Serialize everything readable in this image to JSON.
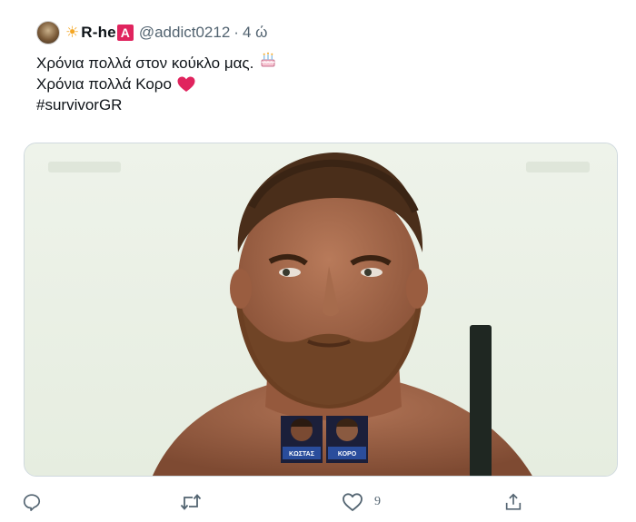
{
  "tweet": {
    "display_name": "R-he",
    "badge_letter": "A",
    "handle": "@addict0212",
    "separator": "·",
    "time": "4 ώ",
    "lines": [
      "Χρόνια πολλά στον κούκλο μας.",
      "Χρόνια πολλά Κορο",
      "#survivorGR"
    ],
    "media": {
      "overlay_labels": [
        "ΚΩΣΤΑΣ",
        "ΚΟΡΟ"
      ]
    }
  },
  "actions": {
    "like_count": "9"
  },
  "icons": {
    "sun": "sun-icon",
    "badge": "letter-a-badge-icon",
    "cake": "birthday-cake-icon",
    "heart_emoji": "red-heart-icon",
    "reply": "reply-icon",
    "retweet": "retweet-icon",
    "like": "like-icon",
    "share": "share-icon"
  },
  "colors": {
    "text": "#0f1419",
    "muted": "#536471",
    "badge": "#e0245e",
    "heart": "#e0245e",
    "border": "#cfd9de"
  }
}
